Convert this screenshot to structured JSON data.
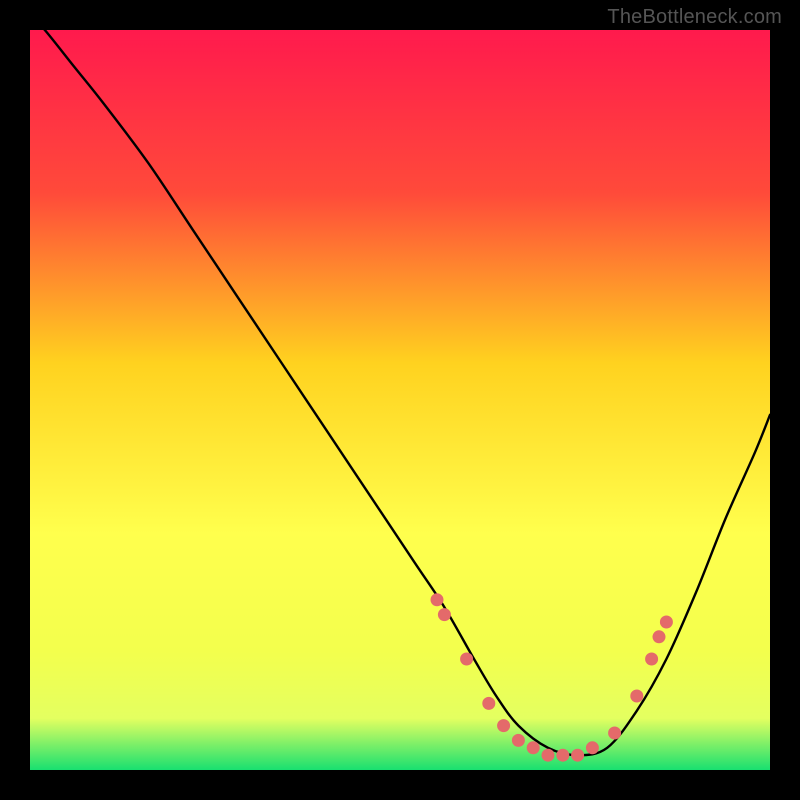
{
  "watermark": "TheBottleneck.com",
  "colors": {
    "frame": "#000000",
    "gradient_top": "#ff1a4d",
    "gradient_mid1": "#ff6a2a",
    "gradient_mid2": "#ffd21f",
    "gradient_mid3": "#ffff4d",
    "gradient_mid4": "#e4ff60",
    "gradient_bottom": "#18e070",
    "curve": "#000000",
    "dots": "#e46a6a"
  },
  "chart_data": {
    "type": "line",
    "title": "",
    "xlabel": "",
    "ylabel": "",
    "xlim": [
      0,
      100
    ],
    "ylim": [
      0,
      100
    ],
    "series": [
      {
        "name": "curve",
        "x": [
          0,
          2,
          6,
          10,
          16,
          22,
          28,
          34,
          40,
          46,
          52,
          56,
          60,
          63,
          66,
          70,
          74,
          78,
          82,
          86,
          90,
          94,
          98,
          100
        ],
        "y": [
          102,
          100,
          95,
          90,
          82,
          73,
          64,
          55,
          46,
          37,
          28,
          22,
          15,
          10,
          6,
          3,
          2,
          3,
          8,
          15,
          24,
          34,
          43,
          48
        ]
      }
    ],
    "points": [
      {
        "x": 55,
        "y": 23
      },
      {
        "x": 56,
        "y": 21
      },
      {
        "x": 59,
        "y": 15
      },
      {
        "x": 62,
        "y": 9
      },
      {
        "x": 64,
        "y": 6
      },
      {
        "x": 66,
        "y": 4
      },
      {
        "x": 68,
        "y": 3
      },
      {
        "x": 70,
        "y": 2
      },
      {
        "x": 72,
        "y": 2
      },
      {
        "x": 74,
        "y": 2
      },
      {
        "x": 76,
        "y": 3
      },
      {
        "x": 79,
        "y": 5
      },
      {
        "x": 82,
        "y": 10
      },
      {
        "x": 84,
        "y": 15
      },
      {
        "x": 85,
        "y": 18
      },
      {
        "x": 86,
        "y": 20
      }
    ]
  }
}
